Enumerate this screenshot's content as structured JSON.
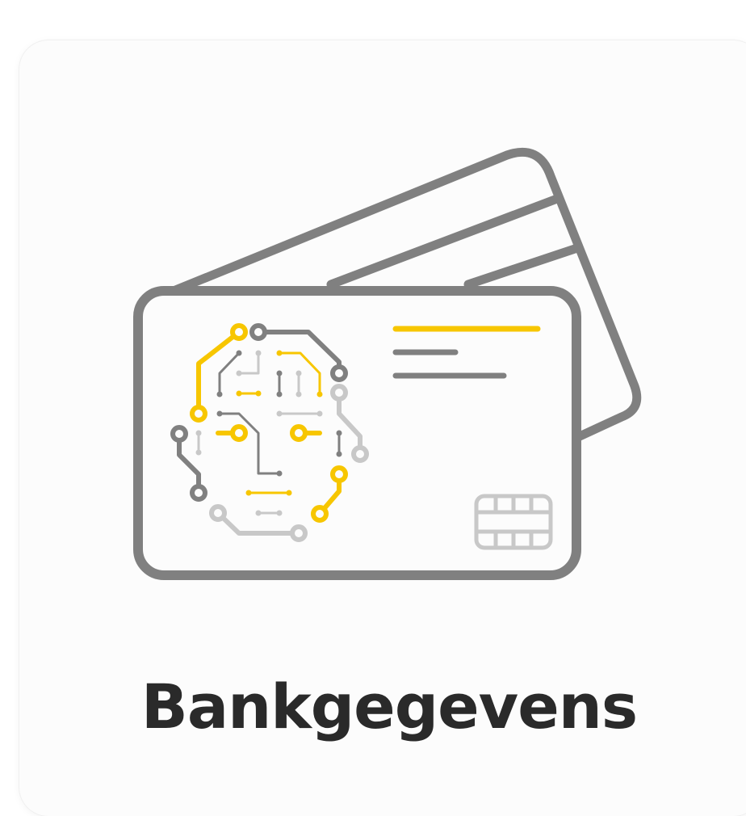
{
  "tile": {
    "label": "Bankgegevens",
    "icon": "ai-circuit-bank-cards-icon"
  },
  "colors": {
    "card_stroke": "#808080",
    "accent_yellow": "#f7c600",
    "circuit_dark": "#808080",
    "circuit_light": "#c8c8c8",
    "tile_background": "#fcfcfc",
    "label_text": "#2a2a2a"
  }
}
